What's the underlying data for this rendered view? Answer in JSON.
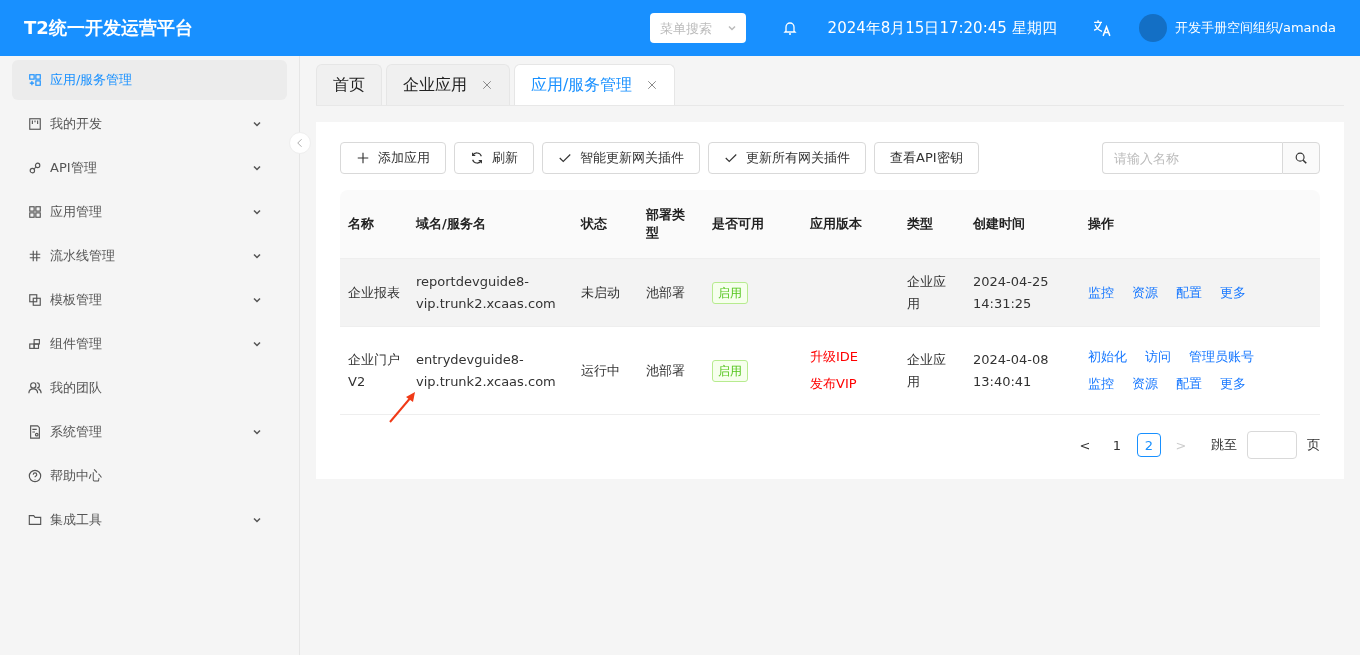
{
  "header": {
    "title": "T2统一开发运营平台",
    "menu_search": {
      "placeholder": "菜单搜索"
    },
    "datetime": "2024年8月15日17:20:45 星期四",
    "user": "开发手册空间组织/amanda"
  },
  "sidebar": {
    "items": [
      {
        "label": "应用/服务管理",
        "kind": "link",
        "selected": true
      },
      {
        "label": "我的开发",
        "kind": "group",
        "selected": false
      },
      {
        "label": "API管理",
        "kind": "group",
        "selected": false
      },
      {
        "label": "应用管理",
        "kind": "group",
        "selected": false
      },
      {
        "label": "流水线管理",
        "kind": "group",
        "selected": false
      },
      {
        "label": "模板管理",
        "kind": "group",
        "selected": false
      },
      {
        "label": "组件管理",
        "kind": "group",
        "selected": false
      },
      {
        "label": "我的团队",
        "kind": "link",
        "selected": false
      },
      {
        "label": "系统管理",
        "kind": "group",
        "selected": false
      },
      {
        "label": "帮助中心",
        "kind": "link",
        "selected": false
      },
      {
        "label": "集成工具",
        "kind": "group",
        "selected": false
      }
    ]
  },
  "tabs": [
    {
      "label": "首页",
      "closable": false,
      "selected": false
    },
    {
      "label": "企业应用",
      "closable": true,
      "selected": false
    },
    {
      "label": "应用/服务管理",
      "closable": true,
      "selected": true
    }
  ],
  "toolbar": {
    "buttons": [
      {
        "label": "添加应用"
      },
      {
        "label": "刷新"
      },
      {
        "label": "智能更新网关插件"
      },
      {
        "label": "更新所有网关插件"
      },
      {
        "label": "查看API密钥"
      }
    ],
    "search": {
      "placeholder": "请输入名称"
    }
  },
  "table": {
    "columns": [
      "名称",
      "域名/服务名",
      "状态",
      "部署类型",
      "是否可用",
      "应用版本",
      "类型",
      "创建时间",
      "操作"
    ],
    "rows": [
      {
        "name": "企业报表",
        "domain": "reportdevguide8-vip.trunk2.xcaas.com",
        "status": "未启动",
        "deploy": "池部署",
        "available": "启用",
        "versions": [],
        "type": "企业应用",
        "created": "2024-04-25 14:31:25",
        "actions": [
          [
            "监控",
            "资源",
            "配置",
            "更多"
          ]
        ],
        "highlighted": true
      },
      {
        "name": "企业门户V2",
        "domain": "entrydevguide8-vip.trunk2.xcaas.com",
        "status": "运行中",
        "deploy": "池部署",
        "available": "启用",
        "versions": [
          "升级IDE",
          "发布VIP"
        ],
        "type": "企业应用",
        "created": "2024-04-08 13:40:41",
        "actions": [
          [
            "初始化",
            "访问",
            "管理员账号"
          ],
          [
            "监控",
            "资源",
            "配置",
            "更多"
          ]
        ],
        "highlighted": false
      }
    ]
  },
  "pagination": {
    "prev": "<",
    "pages": [
      {
        "label": "1",
        "selected": false
      },
      {
        "label": "2",
        "selected": true
      }
    ],
    "next": ">",
    "jump_label": "跳至",
    "page_unit": "页"
  }
}
